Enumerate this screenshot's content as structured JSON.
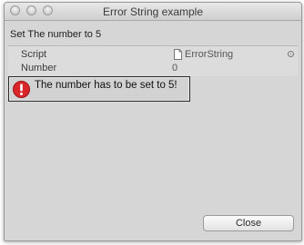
{
  "window": {
    "title": "Error String example"
  },
  "message": "Set The number to 5",
  "inspector": {
    "rows": [
      {
        "label": "Script",
        "value": "ErrorString",
        "value_icon": "file-icon",
        "trailing_icon": "target-icon"
      },
      {
        "label": "Number",
        "value": "0"
      }
    ]
  },
  "error": {
    "icon": "error-icon",
    "text": "The number has to be set to 5!",
    "icon_color": "#d8262a"
  },
  "buttons": {
    "close_label": "Close"
  }
}
